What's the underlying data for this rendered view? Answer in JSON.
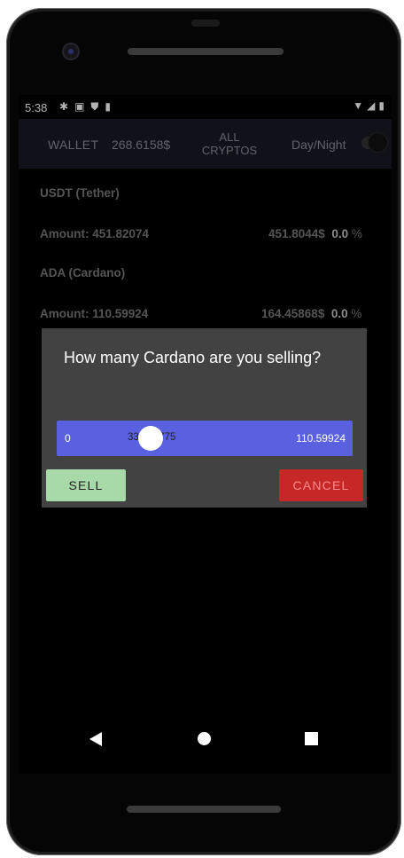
{
  "status_bar": {
    "time": "5:38",
    "icons": [
      "gear-icon",
      "sim-icon",
      "shield-icon",
      "sd-card-icon"
    ],
    "right_icons": [
      "wifi-icon",
      "signal-icon",
      "battery-icon"
    ]
  },
  "app_bar": {
    "wallet_label": "WALLET",
    "balance": "268.6158$",
    "all_cryptos_line1": "ALL",
    "all_cryptos_line2": "CRYPTOS",
    "day_night_label": "Day/Night",
    "toggle_on": false
  },
  "holdings": [
    {
      "name": "USDT (Tether)",
      "amount_label": "Amount: 451.82074",
      "value": "451.8044$",
      "pct": "0.0",
      "pct_sym": "%"
    },
    {
      "name": "ADA (Cardano)",
      "amount_label": "Amount: 110.59924",
      "value": "164.45868$",
      "pct": "0.0",
      "pct_sym": "%"
    }
  ],
  "dialog": {
    "title": "How many Cardano are you selling?",
    "slider": {
      "min_label": "0",
      "max_label": "110.59924",
      "value_label": "33.179775",
      "fraction": 0.3
    },
    "sell_label": "SELL",
    "cancel_label": "CANCEL"
  },
  "colors": {
    "app_bar_bg": "#191926",
    "slider_bg": "#5a61e0",
    "sell_bg": "#a7d9a9",
    "cancel_bg": "#c62828",
    "cancel_text": "#ff8a8a",
    "dialog_bg": "#424242"
  },
  "nav_icons": [
    "back-icon",
    "home-icon",
    "recents-icon"
  ]
}
